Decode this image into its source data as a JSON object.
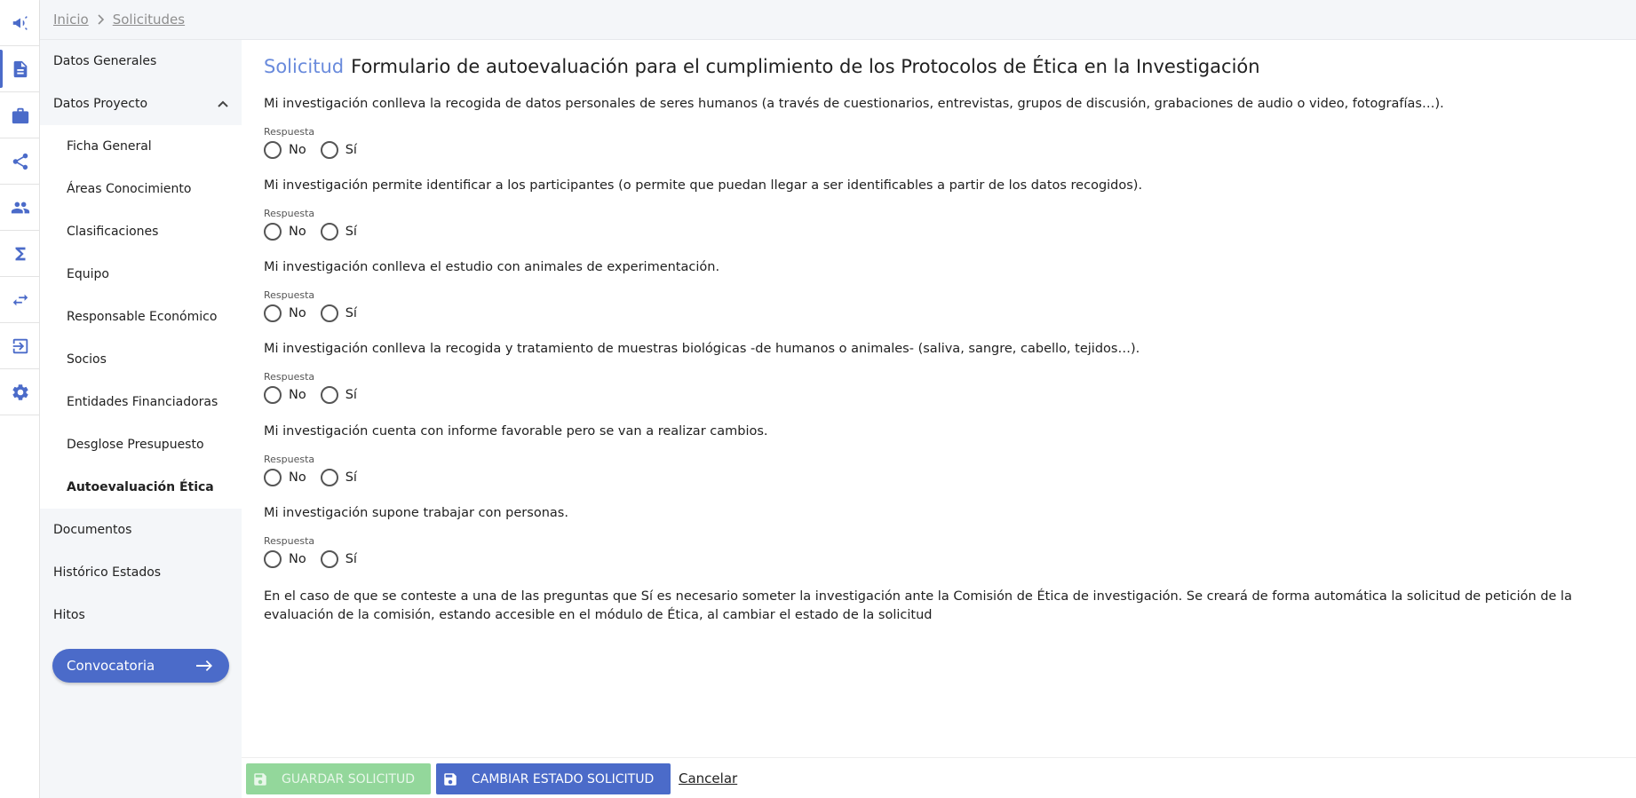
{
  "breadcrumb": [
    "Inicio",
    "Solicitudes"
  ],
  "rail": {
    "icons": [
      "megaphone-icon",
      "document-icon",
      "briefcase-icon",
      "share-icon",
      "people-icon",
      "sigma-icon",
      "swap-icon",
      "logout-icon",
      "gear-icon"
    ],
    "active": "document-icon"
  },
  "sidebar": {
    "items": [
      {
        "label": "Datos Generales"
      },
      {
        "label": "Datos Proyecto",
        "expanded": true
      },
      {
        "label": "Ficha General"
      },
      {
        "label": "Áreas Conocimiento"
      },
      {
        "label": "Clasificaciones"
      },
      {
        "label": "Equipo"
      },
      {
        "label": "Responsable Económico"
      },
      {
        "label": "Socios"
      },
      {
        "label": "Entidades Financiadoras"
      },
      {
        "label": "Desglose Presupuesto"
      },
      {
        "label": "Autoevaluación Ética",
        "selected": true
      },
      {
        "label": "Documentos"
      },
      {
        "label": "Histórico Estados"
      },
      {
        "label": "Hitos"
      }
    ],
    "convocatoria_button": "Convocatoria"
  },
  "main": {
    "title_prefix": "Solicitud",
    "title": "Formulario de autoevaluación para el cumplimiento de los Protocolos de Ética en la Investigación",
    "response_label": "Respuesta",
    "options": [
      "No",
      "Sí"
    ],
    "questions": [
      "Mi investigación conlleva la recogida de datos personales de seres humanos (a través de cuestionarios, entrevistas, grupos de discusión, grabaciones de audio o video, fotografías…).",
      "Mi investigación permite identificar a los participantes (o permite que puedan llegar a ser identificables a partir de los datos recogidos).",
      "Mi investigación conlleva el estudio con animales de experimentación.",
      "Mi investigación conlleva la recogida y tratamiento de muestras biológicas -de humanos o animales- (saliva, sangre, cabello, tejidos…).",
      "Mi investigación cuenta con informe favorable pero se van a realizar cambios.",
      "Mi investigación supone trabajar con personas."
    ],
    "note": "En el caso de que se conteste a una de las preguntas que Sí es necesario someter la investigación ante la Comisión de Ética de investigación. Se creará de forma automática la solicitud de petición de la evaluación de la comisión, estando accesible en el módulo de Ética, al cambiar el estado de la solicitud"
  },
  "actions": {
    "save": "GUARDAR SOLICITUD",
    "change_state": "CAMBIAR ESTADO SOLICITUD",
    "cancel": "Cancelar"
  },
  "colors": {
    "accent": "#4b6bc9",
    "title_prefix": "#6a8bdc",
    "save_button": "#93d79b",
    "sidebar_bg": "#f4f6f9"
  }
}
